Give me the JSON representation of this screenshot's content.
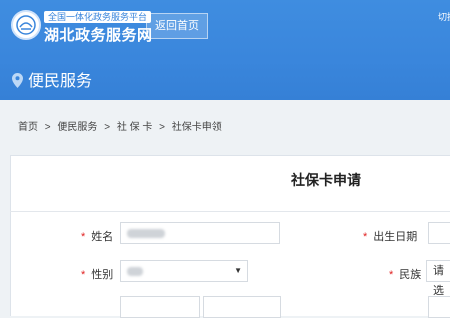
{
  "header": {
    "tagline": "全国一体化政务服务平台",
    "site_title": "湖北政务服务网",
    "home_button": "返回首页",
    "switch_link": "切换",
    "page_heading": "便民服务"
  },
  "breadcrumb": [
    "首页",
    ">",
    "便民服务",
    ">",
    "社 保 卡",
    ">",
    "社保卡申领"
  ],
  "form": {
    "title": "社保卡申请",
    "required_mark": "*",
    "fields": {
      "name_label": "姓名",
      "birth_label": "出生日期",
      "gender_label": "性别",
      "ethnicity_label": "民族",
      "ethnicity_placeholder": "请选"
    }
  },
  "colors": {
    "header_blue": "#3a86dc",
    "required_red": "#e02020"
  },
  "icons": [
    "emblem-icon",
    "location-pin-icon",
    "dropdown-caret-icon"
  ]
}
